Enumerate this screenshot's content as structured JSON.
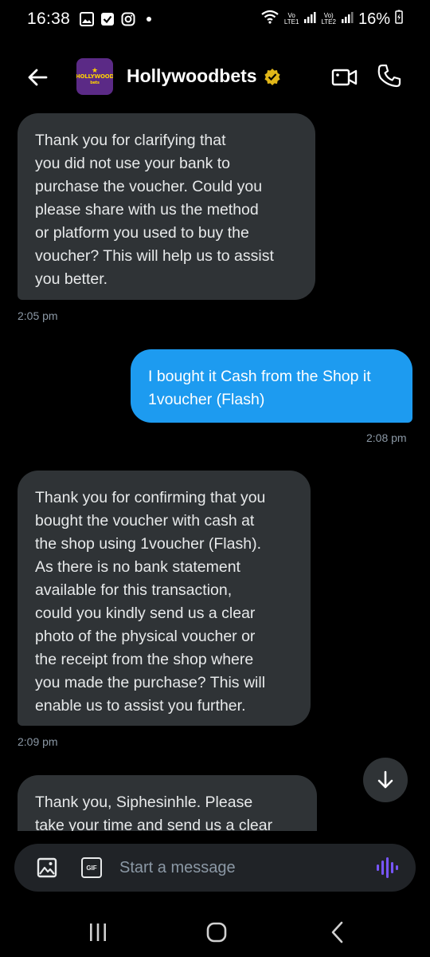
{
  "status_bar": {
    "time": "16:38",
    "net1_label": "Vo\nLTE1",
    "net2_label": "Vo)\nLTE2",
    "battery": "16%"
  },
  "header": {
    "title": "Hollywoodbets",
    "avatar_text": "HOLLYWOOD",
    "avatar_subtext": "bets"
  },
  "messages": [
    {
      "direction": "in",
      "text": "Thank you for clarifying that\nyou did not use your bank to\npurchase the voucher. Could you\nplease share with us the method\nor platform you used to buy the\nvoucher? This will help us to assist\nyou better.",
      "time": "2:05 pm"
    },
    {
      "direction": "out",
      "text": "I bought it Cash from the Shop it\n1voucher  (Flash)",
      "time": "2:08 pm"
    },
    {
      "direction": "in",
      "text": "Thank you for confirming that you\nbought the voucher with cash at\nthe shop using 1voucher (Flash).\nAs there is no bank statement\navailable for this transaction,\ncould you kindly send us a clear\nphoto of the physical voucher or\nthe receipt from the shop where\nyou made the purchase? This will\nenable us to assist you further.",
      "time": "2:09 pm"
    },
    {
      "direction": "in",
      "text": "Thank you, Siphesinhle. Please\ntake your time and send us a clear",
      "time": ""
    }
  ],
  "composer": {
    "placeholder": "Start a message",
    "gif_label": "GIF"
  },
  "colors": {
    "background": "#000000",
    "incoming_bubble": "#2f3336",
    "outgoing_bubble": "#1d9bf0",
    "verified_badge": "#e2b719",
    "voice_accent": "#7856ff",
    "timestamp": "#8b98a5"
  },
  "icons": {
    "back": "arrow-left-icon",
    "verified": "verified-badge-icon",
    "video": "video-camera-icon",
    "call": "phone-icon",
    "scroll": "arrow-down-icon",
    "image": "image-icon",
    "gif": "gif-icon",
    "voice": "voice-wave-icon"
  }
}
